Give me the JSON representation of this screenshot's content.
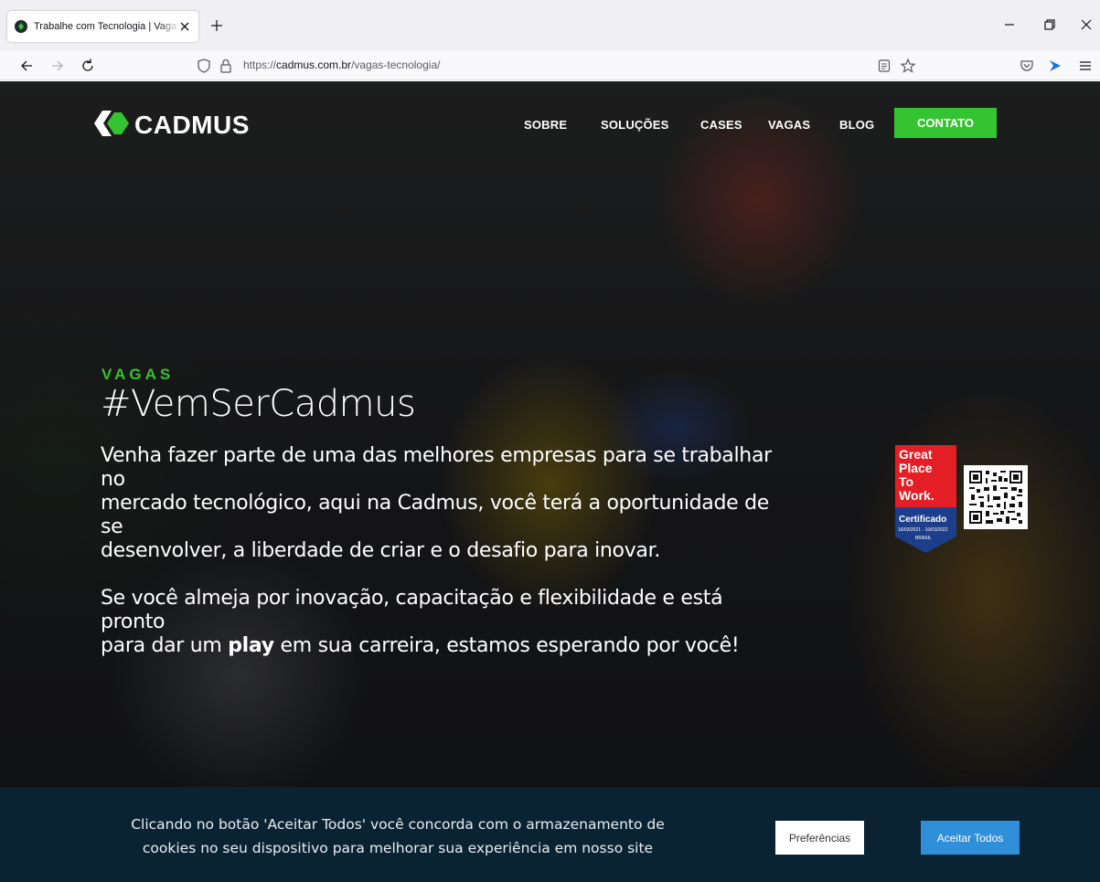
{
  "browser": {
    "tab_title": "Trabalhe com Tecnologia | Vagas",
    "url_prefix": "https://",
    "url_host": "cadmus.com.br",
    "url_path": "/vagas-tecnologia/"
  },
  "site": {
    "logo_text": "CADMUS",
    "nav": [
      "SOBRE",
      "SOLUÇÕES",
      "CASES",
      "VAGAS",
      "BLOG"
    ],
    "contact_label": "CONTATO",
    "colors": {
      "accent_green": "#35c431",
      "accept_blue": "#2f8fd8",
      "cookie_bg": "#0a2333"
    }
  },
  "hero": {
    "eyebrow": "VAGAS",
    "headline": "#VemSerCadmus",
    "para1_lines": [
      "Venha fazer parte de uma das melhores empresas para se trabalhar",
      "no",
      "mercado tecnológico, aqui na Cadmus, você terá a oportunidade de",
      "se",
      "desenvolver, a liberdade de criar e o desafio para inovar."
    ],
    "para2_line1": "Se você almeja por inovação, capacitação e flexibilidade e está",
    "para2_line2": "pronto",
    "para2_line3_pre": "para dar um ",
    "para2_line3_em": "play",
    "para2_line3_post": " em sua carreira, estamos esperando por você!"
  },
  "badge": {
    "lines": [
      "Great",
      "Place",
      "To",
      "Work."
    ],
    "certified": "Certificado",
    "dates": "16/03/2021 - 16/03/2022",
    "country": "BRASIL"
  },
  "cookie": {
    "text_line1": "Clicando no botão 'Aceitar Todos' você concorda com o armazenamento de",
    "text_line2": "cookies no seu dispositivo para melhorar sua experiência em nosso site",
    "preferences_label": "Preferências",
    "accept_label": "Aceitar Todos"
  }
}
